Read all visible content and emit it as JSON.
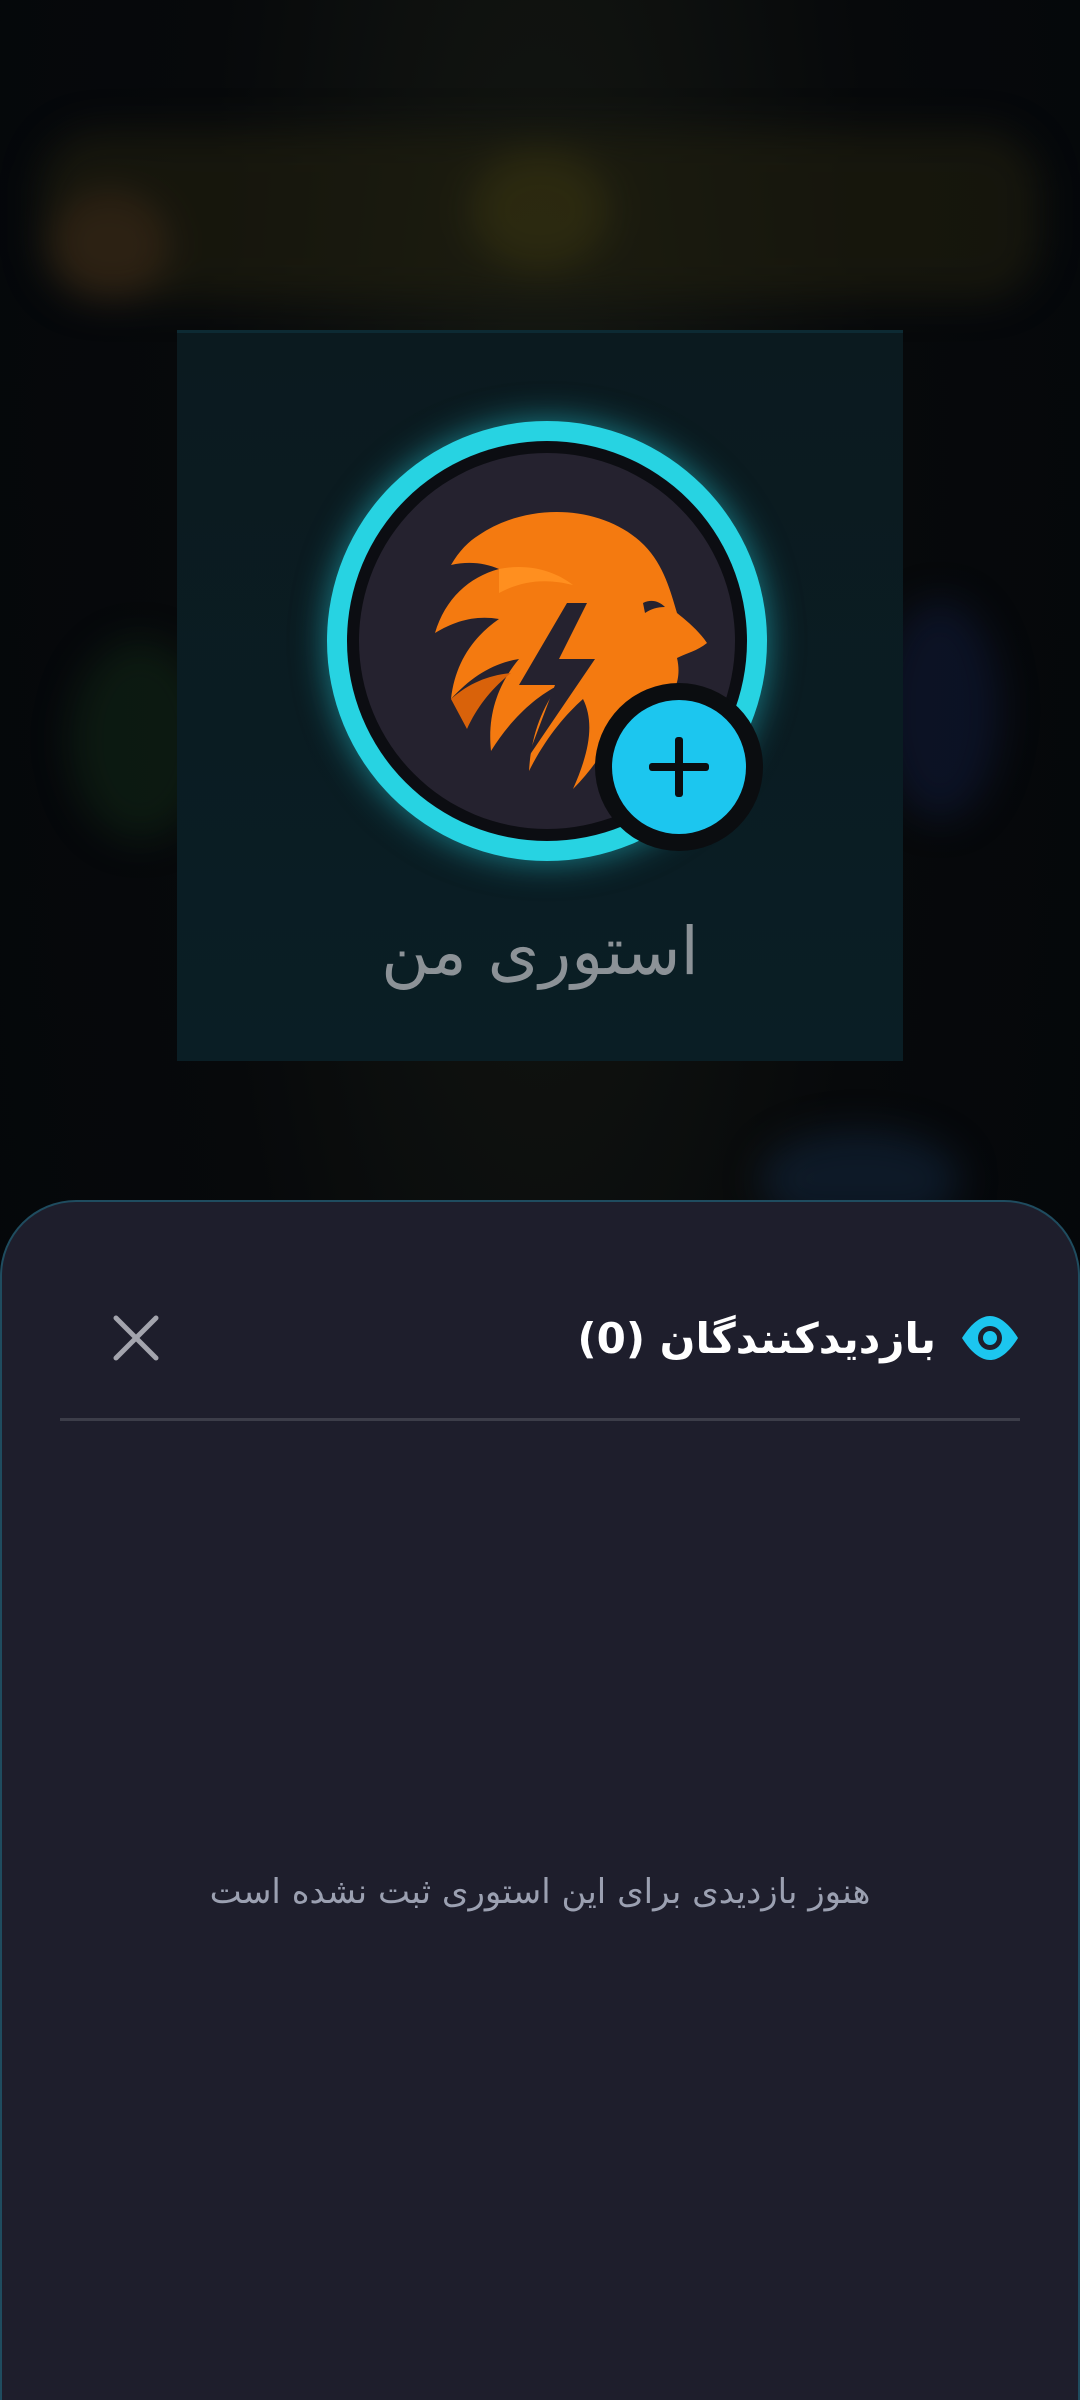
{
  "story_card": {
    "label": "استوری من",
    "avatar_icon": "lion-lightning-logo-icon",
    "add_icon": "plus-icon"
  },
  "viewers_sheet": {
    "title_text": "بازدیدکنندگان (0)",
    "title_icon": "eye-icon",
    "close_icon": "close-icon",
    "empty_message": "هنوز بازدیدی برای این استوری ثبت نشده است"
  },
  "colors": {
    "accent": "#1cc6ef",
    "sheet_background": "#1e1e2c",
    "lion_orange": "#f47a10"
  }
}
